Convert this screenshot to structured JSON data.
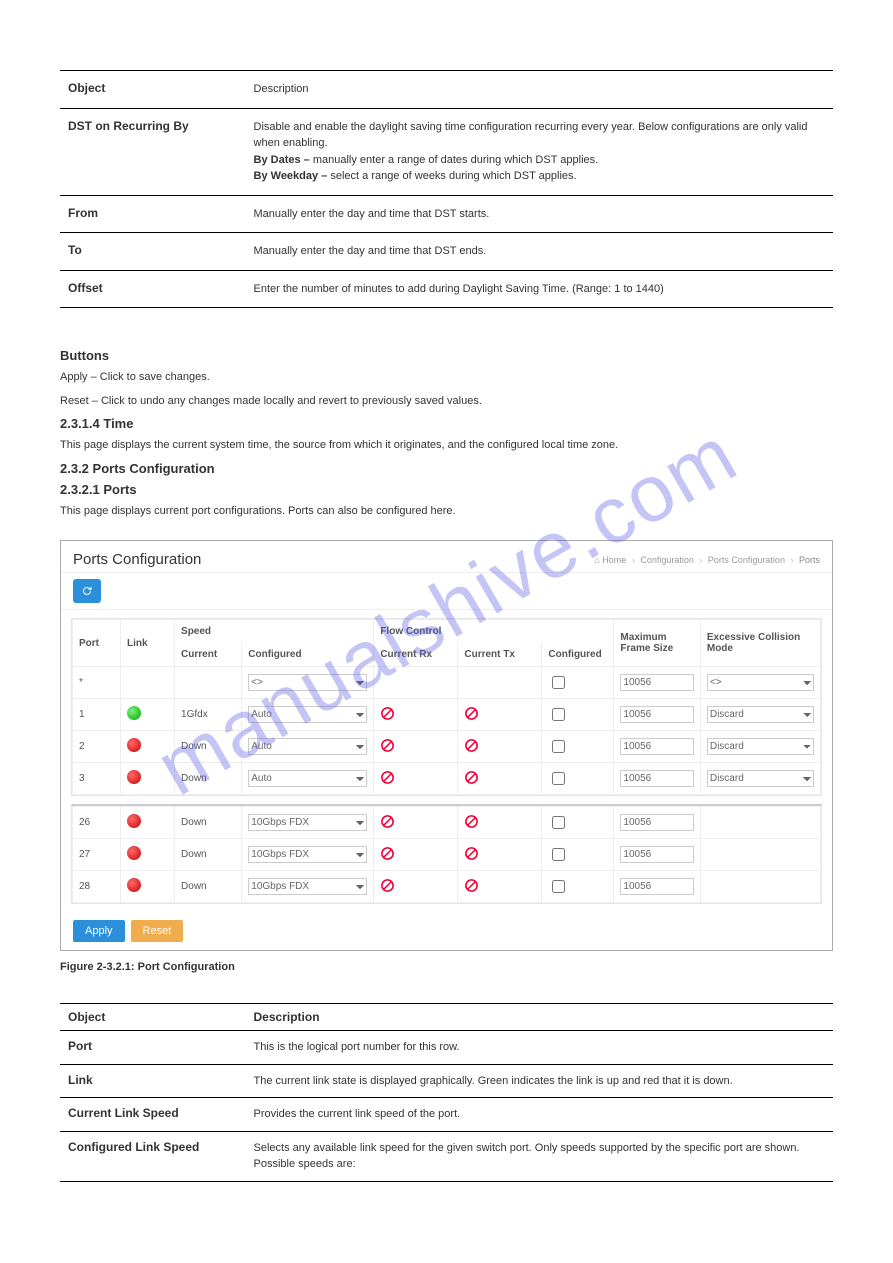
{
  "top_table": {
    "rows": [
      {
        "label": "Object",
        "desc": "Description"
      },
      {
        "label": "DST on Recurring By",
        "desc": "Disable and enable the daylight saving time configuration recurring every year. Below configurations are only valid when enabling.|By Dates – manually enter a range of dates during which DST applies.|By Weekday – select a range of weeks during which DST applies."
      },
      {
        "label": "From",
        "desc": "Manually enter the day and time that DST starts."
      },
      {
        "label": "To",
        "desc": "Manually enter the day and time that DST ends."
      },
      {
        "label": "Offset",
        "desc": "Enter the number of minutes to add during Daylight Saving Time. (Range: 1 to 1440)"
      }
    ]
  },
  "midsection": {
    "buttons_heading": "Buttons",
    "apply_line": "Apply – Click to save changes.",
    "reset_line": "Reset – Click to undo any changes made locally and revert to previously saved values.",
    "heading": "2.3.1.4 Time",
    "para1": "This page displays the current system time, the source from which it originates, and the configured local time zone.",
    "section_hdr": "2.3.2 Ports Configuration",
    "section_sub": "2.3.2.1 Ports",
    "para2": "This page displays current port configurations. Ports can also be configured here."
  },
  "shot": {
    "title": "Ports Configuration",
    "breadcrumb": {
      "home": "Home",
      "b1": "Configuration",
      "b2": "Ports Configuration",
      "b3": "Ports"
    },
    "headers": {
      "port": "Port",
      "link": "Link",
      "speed": "Speed",
      "speed_current": "Current",
      "speed_configured": "Configured",
      "flow": "Flow Control",
      "flow_rx": "Current Rx",
      "flow_tx": "Current Tx",
      "flow_cfg": "Configured",
      "mfs": "Maximum Frame Size",
      "ecm": "Excessive Collision Mode"
    },
    "rows_a": [
      {
        "port": "*",
        "link": "",
        "speed_current": "",
        "speed_cfg": "<>",
        "rx": "",
        "tx": "",
        "cfg": false,
        "mfs": "10056",
        "ecm": "<>"
      },
      {
        "port": "1",
        "link": "green",
        "speed_current": "1Gfdx",
        "speed_cfg": "Auto",
        "rx": "no",
        "tx": "no",
        "cfg": false,
        "mfs": "10056",
        "ecm": "Discard"
      },
      {
        "port": "2",
        "link": "red",
        "speed_current": "Down",
        "speed_cfg": "Auto",
        "rx": "no",
        "tx": "no",
        "cfg": false,
        "mfs": "10056",
        "ecm": "Discard"
      },
      {
        "port": "3",
        "link": "red",
        "speed_current": "Down",
        "speed_cfg": "Auto",
        "rx": "no",
        "tx": "no",
        "cfg": false,
        "mfs": "10056",
        "ecm": "Discard"
      }
    ],
    "rows_b": [
      {
        "port": "26",
        "link": "red",
        "speed_current": "Down",
        "speed_cfg": "10Gbps FDX",
        "rx": "no",
        "tx": "no",
        "cfg": false,
        "mfs": "10056",
        "ecm": ""
      },
      {
        "port": "27",
        "link": "red",
        "speed_current": "Down",
        "speed_cfg": "10Gbps FDX",
        "rx": "no",
        "tx": "no",
        "cfg": false,
        "mfs": "10056",
        "ecm": ""
      },
      {
        "port": "28",
        "link": "red",
        "speed_current": "Down",
        "speed_cfg": "10Gbps FDX",
        "rx": "no",
        "tx": "no",
        "cfg": false,
        "mfs": "10056",
        "ecm": ""
      }
    ],
    "buttons": {
      "apply": "Apply",
      "reset": "Reset"
    }
  },
  "fig_label": "Figure 2-3.2.1: Port Configuration",
  "bottom_table": {
    "header": {
      "obj": "Object",
      "desc": "Description"
    },
    "rows": [
      {
        "label": "Port",
        "desc": "This is the logical port number for this row."
      },
      {
        "label": "Link",
        "desc": "The current link state is displayed graphically. Green indicates the link is up and red that it is down."
      },
      {
        "label": "Current Link Speed",
        "desc": "Provides the current link speed of the port."
      },
      {
        "label": "Configured Link Speed",
        "desc": "Selects any available link speed for the given switch port. Only speeds supported by the specific port are shown. Possible speeds are:"
      }
    ]
  }
}
